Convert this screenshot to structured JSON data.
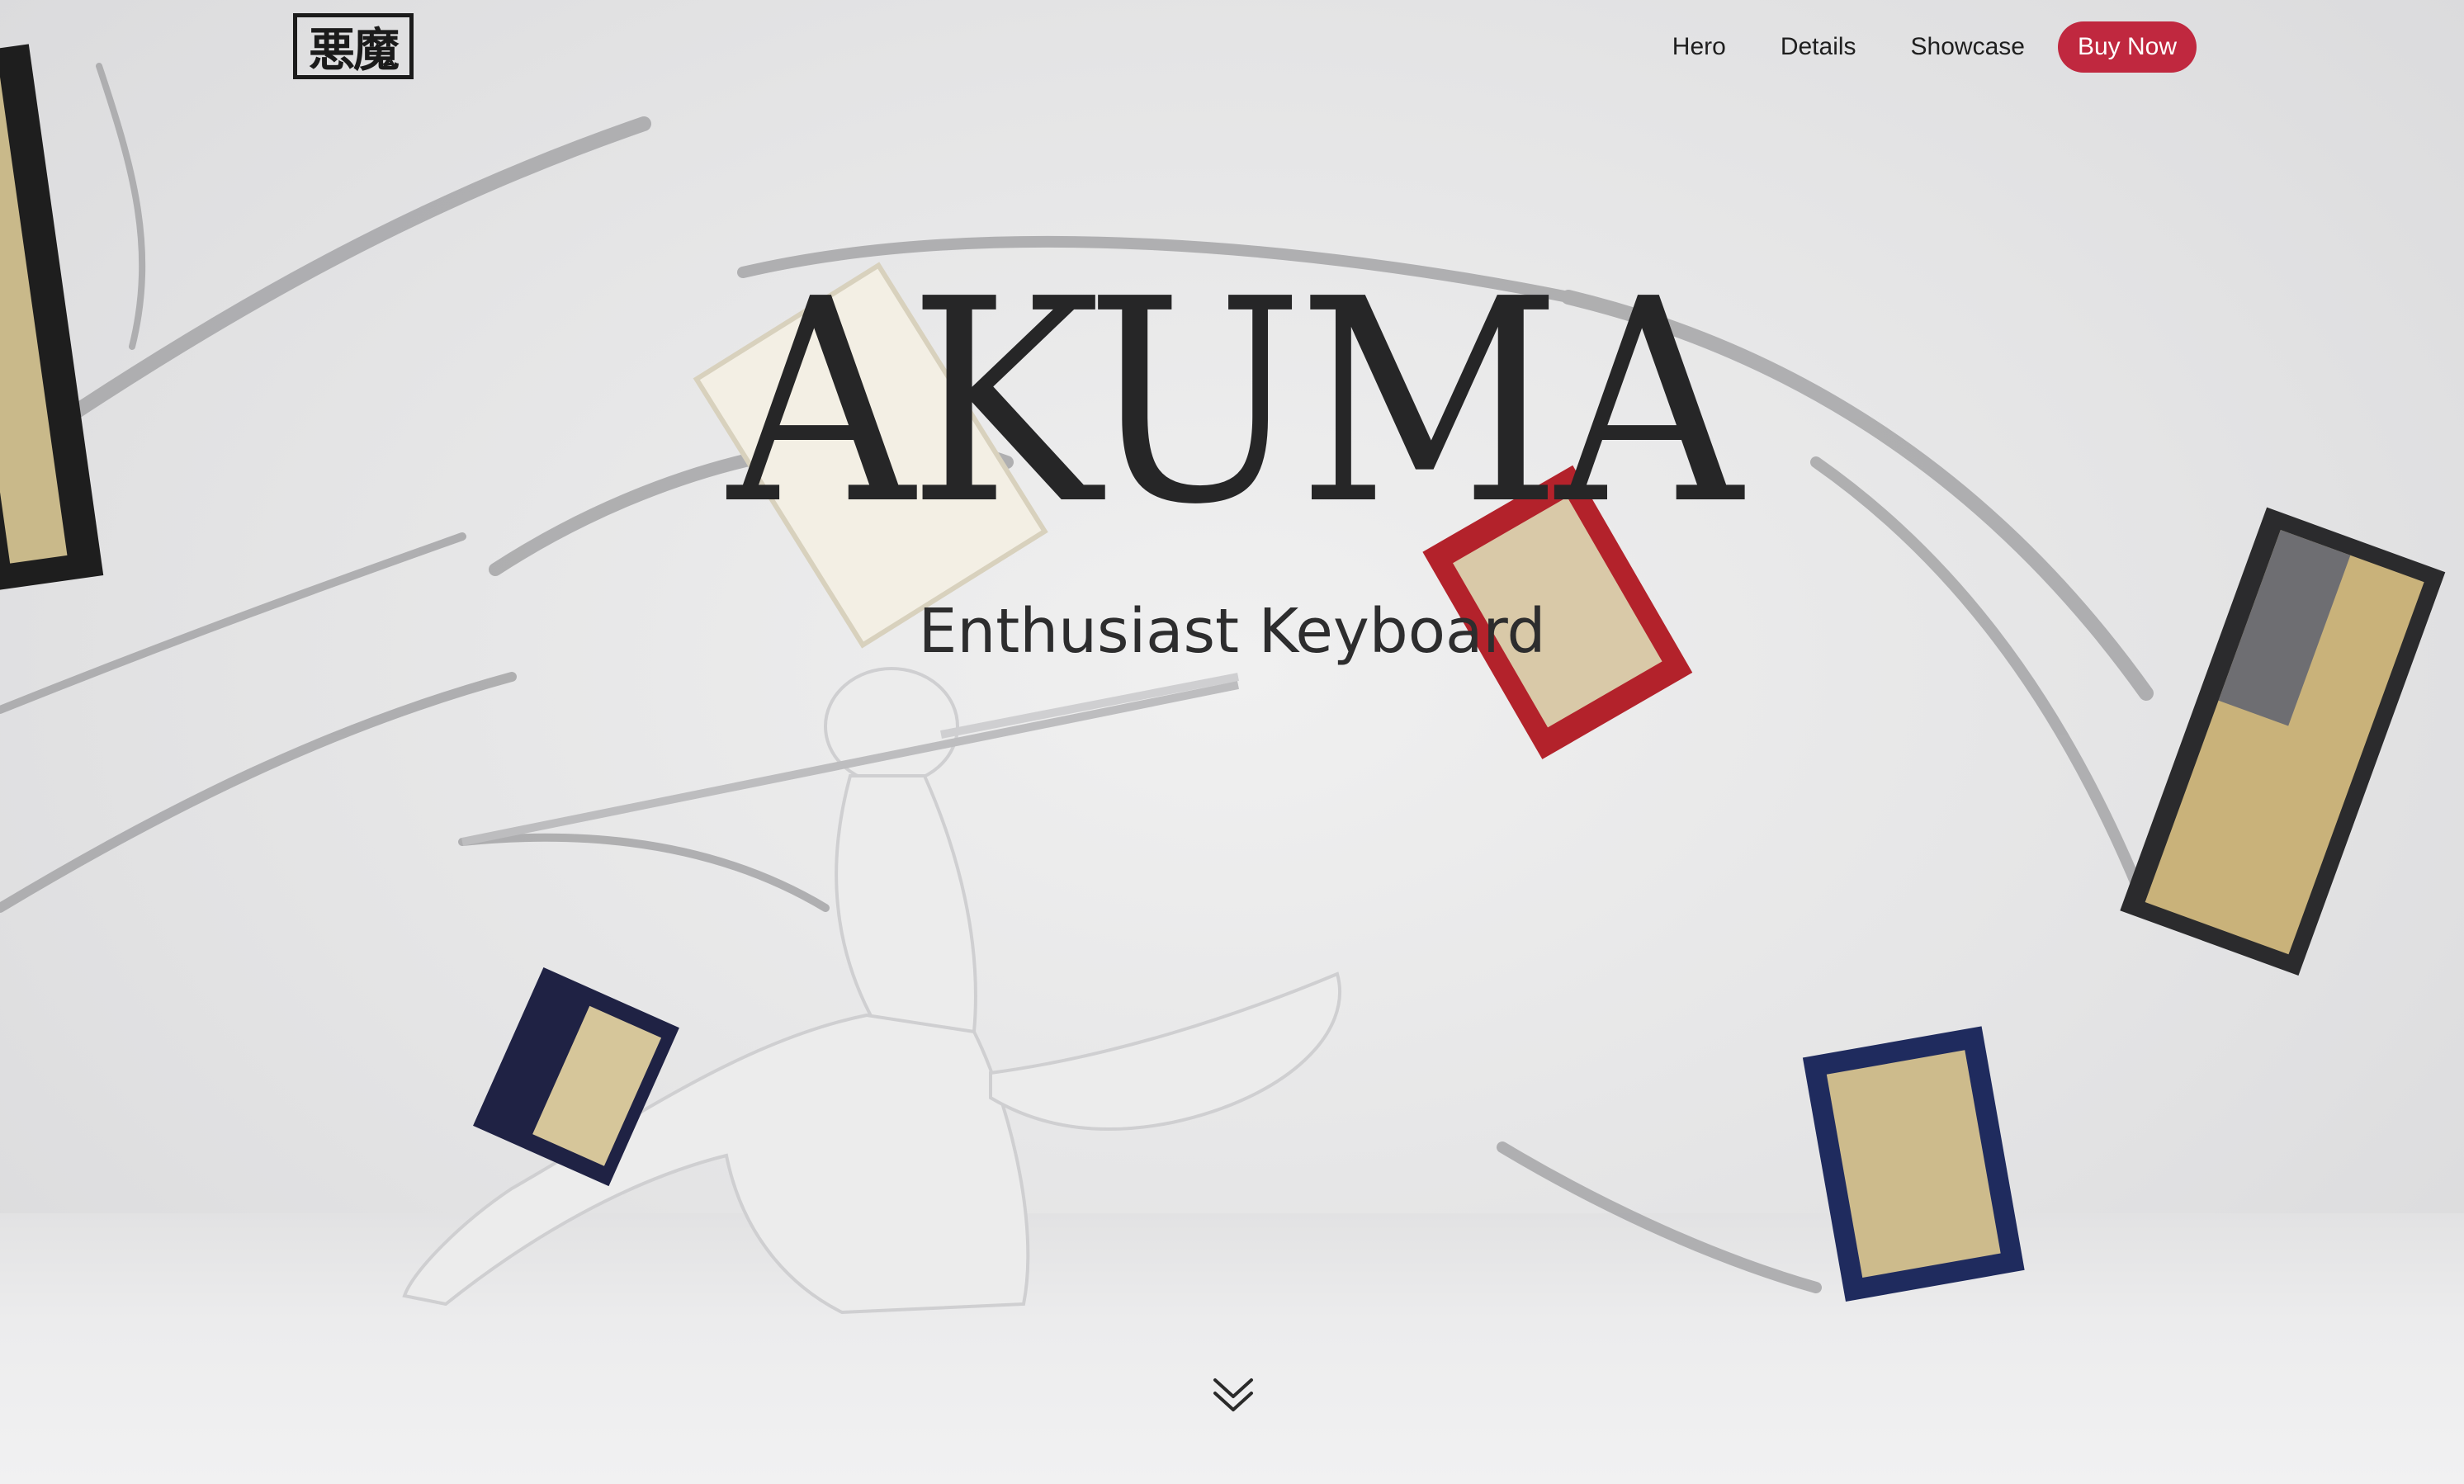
{
  "header": {
    "logo_text": "悪魔",
    "nav": [
      {
        "label": "Hero"
      },
      {
        "label": "Details"
      },
      {
        "label": "Showcase"
      }
    ],
    "cta_label": "Buy Now",
    "cta_color": "#c0283f"
  },
  "hero": {
    "title": "AKUMA",
    "subtitle": "Enthusiast Keyboard",
    "scroll_icon": "double-chevron-down-icon"
  }
}
